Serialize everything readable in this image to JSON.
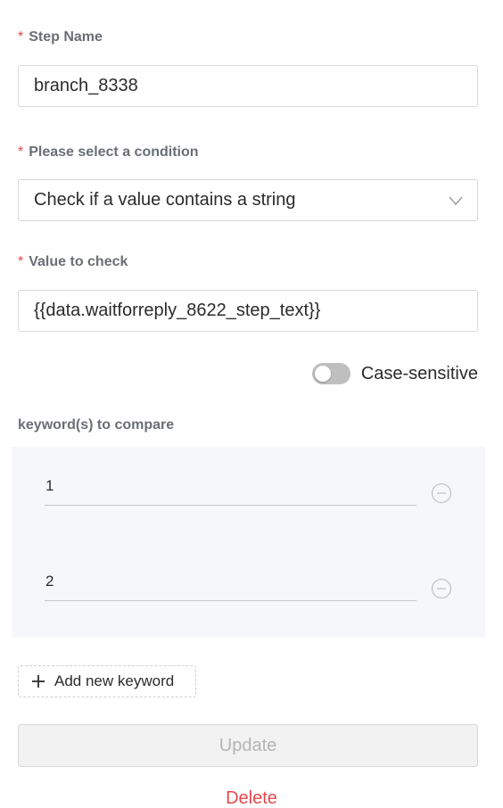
{
  "step_name": {
    "label": "Step Name",
    "required_mark": "*",
    "value": "branch_8338"
  },
  "condition": {
    "label": "Please select a condition",
    "required_mark": "*",
    "selected": "Check if a value contains a string",
    "icon": "chevron-down-icon"
  },
  "value_to_check": {
    "label": "Value to check",
    "required_mark": "*",
    "value": "{{data.waitforreply_8622_step_text}}"
  },
  "case_sensitive": {
    "label": "Case-sensitive",
    "enabled": false
  },
  "keywords": {
    "label": "keyword(s) to compare",
    "items": [
      {
        "value": "1",
        "remove_icon": "minus-circle-icon"
      },
      {
        "value": "2",
        "remove_icon": "minus-circle-icon"
      }
    ],
    "add_label": "Add new keyword",
    "add_icon": "plus-icon"
  },
  "actions": {
    "update_label": "Update",
    "delete_label": "Delete"
  },
  "colors": {
    "required": "#e5484d",
    "delete": "#e5484d",
    "label": "#6b6e76",
    "panel_bg": "#f5f7fa",
    "disabled_text": "#b4b4b4"
  }
}
